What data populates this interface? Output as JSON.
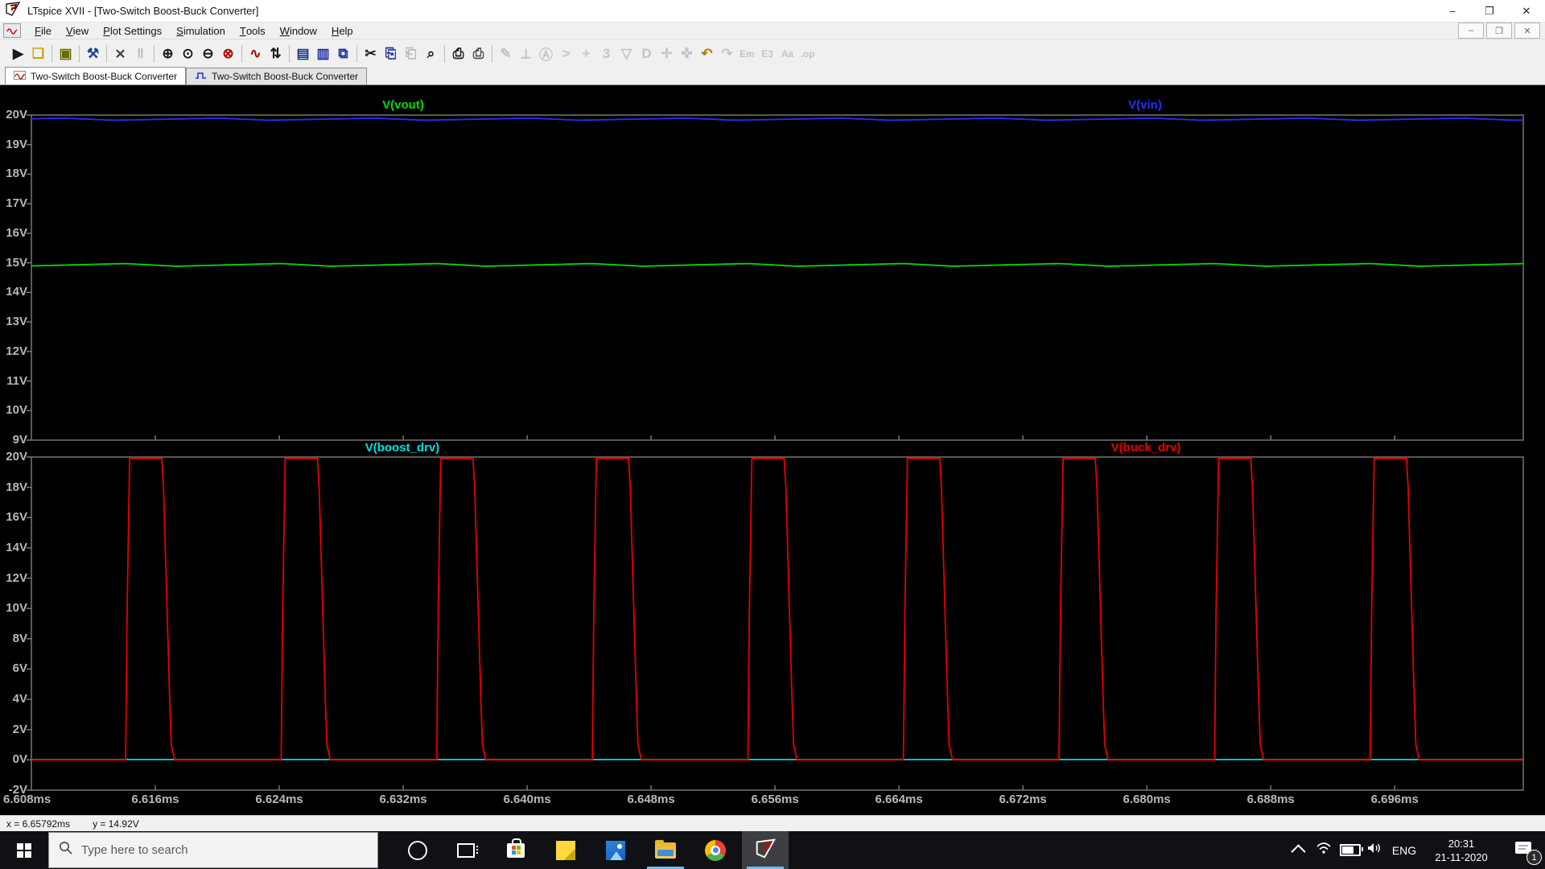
{
  "window": {
    "title": "LTspice XVII - [Two-Switch Boost-Buck Converter]",
    "controls": {
      "minimize": "–",
      "restore": "❐",
      "close": "✕"
    }
  },
  "menubar": {
    "items": [
      "File",
      "View",
      "Plot Settings",
      "Simulation",
      "Tools",
      "Window",
      "Help"
    ],
    "mdi_controls": {
      "minimize": "–",
      "restore": "❐",
      "close": "✕"
    }
  },
  "toolbar": {
    "groups": [
      [
        {
          "name": "run-icon",
          "glyph": "▶",
          "color": "#1a1a1a"
        },
        {
          "name": "open-folder-icon",
          "glyph": "❏",
          "color": "#c9a004"
        }
      ],
      [
        {
          "name": "save-icon",
          "glyph": "▣",
          "color": "#6b6b00"
        }
      ],
      [
        {
          "name": "control-panel-hammer-icon",
          "glyph": "⚒",
          "color": "#1b3f8f"
        }
      ],
      [
        {
          "name": "edit-tools-icon",
          "glyph": "⨯",
          "color": "#3a3a3a"
        },
        {
          "name": "halt-icon",
          "glyph": "‖",
          "color": "#8a8a8a",
          "disabled": true
        }
      ],
      [
        {
          "name": "zoom-in-icon",
          "glyph": "⊕",
          "color": "#1a1a1a"
        },
        {
          "name": "zoom-pan-icon",
          "glyph": "⊙",
          "color": "#1a1a1a"
        },
        {
          "name": "zoom-out-icon",
          "glyph": "⊖",
          "color": "#1a1a1a"
        },
        {
          "name": "zoom-extents-icon",
          "glyph": "⊗",
          "color": "#b00000"
        }
      ],
      [
        {
          "name": "autorange-icon",
          "glyph": "∿",
          "color": "#b00000"
        },
        {
          "name": "autoscale-y-icon",
          "glyph": "⇅",
          "color": "#1a1a1a"
        }
      ],
      [
        {
          "name": "tile-vertical-icon",
          "glyph": "▤",
          "color": "#1f2f9f"
        },
        {
          "name": "tile-horizontal-icon",
          "glyph": "▥",
          "color": "#1f2f9f"
        },
        {
          "name": "cascade-windows-icon",
          "glyph": "⧉",
          "color": "#1f2f9f"
        }
      ],
      [
        {
          "name": "cut-icon",
          "glyph": "✂",
          "color": "#1a1a1a"
        },
        {
          "name": "copy-icon",
          "glyph": "⎘",
          "color": "#1f2f9f"
        },
        {
          "name": "paste-icon",
          "glyph": "⎗",
          "color": "#8a8a8a",
          "disabled": true
        },
        {
          "name": "find-icon",
          "glyph": "⌕",
          "color": "#1a1a1a"
        }
      ],
      [
        {
          "name": "print-icon",
          "glyph": "⎙",
          "color": "#1a1a1a"
        },
        {
          "name": "print-preview-icon",
          "glyph": "⎙",
          "color": "#555555"
        }
      ],
      [
        {
          "name": "draw-wire-icon",
          "glyph": "✎",
          "color": "#9a9a9a",
          "disabled": true
        },
        {
          "name": "ground-icon",
          "glyph": "⟂",
          "color": "#9a9a9a",
          "disabled": true
        },
        {
          "name": "net-label-icon",
          "glyph": "Ⓐ",
          "color": "#9a9a9a",
          "disabled": true
        },
        {
          "name": "resistor-icon",
          "glyph": ">",
          "color": "#9a9a9a",
          "disabled": true
        },
        {
          "name": "capacitor-icon",
          "glyph": "+",
          "color": "#9a9a9a",
          "disabled": true
        },
        {
          "name": "inductor-icon",
          "glyph": "3",
          "color": "#9a9a9a",
          "disabled": true
        },
        {
          "name": "diode-icon",
          "glyph": "▽",
          "color": "#9a9a9a",
          "disabled": true
        },
        {
          "name": "component-icon",
          "glyph": "D",
          "color": "#9a9a9a",
          "disabled": true
        },
        {
          "name": "move-icon",
          "glyph": "✛",
          "color": "#9a9a9a",
          "disabled": true
        },
        {
          "name": "drag-icon",
          "glyph": "✜",
          "color": "#9a9a9a",
          "disabled": true
        },
        {
          "name": "undo-icon",
          "glyph": "↶",
          "color": "#b08000"
        },
        {
          "name": "redo-icon",
          "glyph": "↷",
          "color": "#9a9a9a",
          "disabled": true
        },
        {
          "name": "mirror-icon",
          "glyph": "Em",
          "color": "#9a9a9a",
          "disabled": true,
          "small": true
        },
        {
          "name": "rotate-icon",
          "glyph": "E3",
          "color": "#9a9a9a",
          "disabled": true,
          "small": true
        },
        {
          "name": "text-icon",
          "glyph": "Aa",
          "color": "#9a9a9a",
          "disabled": true,
          "small": true
        },
        {
          "name": "spice-directive-icon",
          "glyph": ".op",
          "color": "#9a9a9a",
          "disabled": true,
          "small": true
        }
      ]
    ]
  },
  "tabs": [
    {
      "label": "Two-Switch Boost-Buck Converter",
      "icon": "waveform",
      "active": true
    },
    {
      "label": "Two-Switch Boost-Buck Converter",
      "icon": "schematic",
      "active": false
    }
  ],
  "chart_data": [
    {
      "type": "line",
      "pane": "top",
      "ylim": [
        9,
        20
      ],
      "xlim_ms": [
        6.608,
        6.7043
      ],
      "y_tick_labels": [
        "20V",
        "19V",
        "18V",
        "17V",
        "16V",
        "15V",
        "14V",
        "13V",
        "12V",
        "11V",
        "10V",
        "9V"
      ],
      "grid": false,
      "legend_position": "inline-top",
      "series": [
        {
          "name": "V(vout)",
          "color": "#00dc00",
          "kind": "ripple",
          "base_v": 14.93,
          "amp_v": 0.045,
          "period_ms": 0.010042,
          "phase_ms": 6.61408
        },
        {
          "name": "V(vin)",
          "color": "#2b2bff",
          "kind": "ripple",
          "base_v": 19.86,
          "amp_v": 0.035,
          "period_ms": 0.010042,
          "phase_ms": 6.61008
        }
      ]
    },
    {
      "type": "line",
      "pane": "bottom",
      "ylim": [
        -2,
        20
      ],
      "xlim_ms": [
        6.608,
        6.7043
      ],
      "y_tick_labels": [
        "20V",
        "18V",
        "16V",
        "14V",
        "12V",
        "10V",
        "8V",
        "6V",
        "4V",
        "2V",
        "0V",
        "-2V"
      ],
      "x_ticks_ms": [
        6.608,
        6.616,
        6.624,
        6.632,
        6.64,
        6.648,
        6.656,
        6.664,
        6.672,
        6.68,
        6.688,
        6.696
      ],
      "x_tick_labels": [
        "6.608ms",
        "6.616ms",
        "6.624ms",
        "6.632ms",
        "6.640ms",
        "6.648ms",
        "6.656ms",
        "6.664ms",
        "6.672ms",
        "6.680ms",
        "6.688ms",
        "6.696ms"
      ],
      "grid": false,
      "legend_position": "inline-top",
      "series": [
        {
          "name": "V(boost_drv)",
          "color": "#00e0e0",
          "kind": "constant",
          "base_v": 0.02
        },
        {
          "name": "V(buck_drv)",
          "color": "#e60000",
          "kind": "pulse",
          "low_v": 0,
          "high_v": 19.9,
          "first_rise_ms": 6.61408,
          "period_ms": 0.010042,
          "pulse_count": 9,
          "shape_rel_ms_v": [
            [
              0,
              0
            ],
            [
              0.0001,
              10
            ],
            [
              0.00026,
              19.9
            ],
            [
              0.00234,
              19.9
            ],
            [
              0.00245,
              18
            ],
            [
              0.00285,
              4
            ],
            [
              0.00295,
              1
            ],
            [
              0.00317,
              0
            ]
          ]
        }
      ]
    }
  ],
  "statusbar": {
    "x_readout": "x = 6.65792ms",
    "y_readout": "y = 14.92V"
  },
  "taskbar": {
    "search_placeholder": "Type here to search",
    "language": "ENG",
    "time": "20:31",
    "date": "21-11-2020",
    "notification_count": "1"
  }
}
